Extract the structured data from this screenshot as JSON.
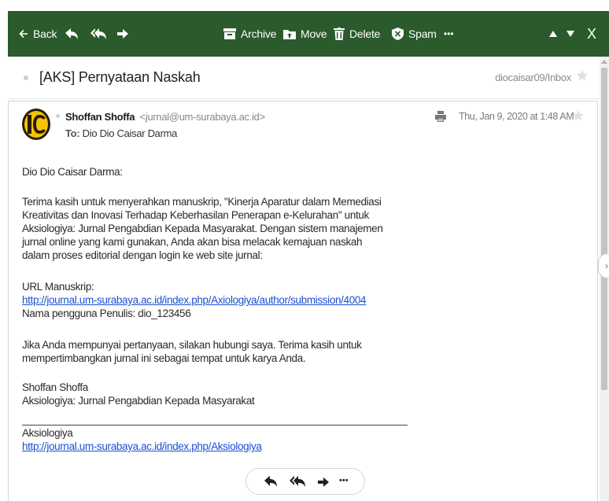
{
  "toolbar": {
    "back_label": "Back",
    "archive_label": "Archive",
    "move_label": "Move",
    "delete_label": "Delete",
    "spam_label": "Spam",
    "more_label": "•••",
    "close_label": "X"
  },
  "subject": {
    "title": "[AKS] Pernyataan Naskah",
    "folder": "diocaisar09/Inbox"
  },
  "message": {
    "sender_name": "Shoffan Shoffa",
    "sender_email": "<jurnal@um-surabaya.ac.id>",
    "to_label": "To:",
    "to_value": "Dio Dio Caisar Darma",
    "date": "Thu, Jan 9, 2020 at 1:48 AM",
    "greeting": "Dio Dio Caisar Darma:",
    "para1_lines": [
      "Terima kasih untuk menyerahkan manuskrip, \"Kinerja Aparatur dalam Memediasi",
      "Kreativitas dan Inovasi Terhadap Keberhasilan Penerapan e-Kelurahan\" untuk",
      "Aksiologiya: Jurnal Pengabdian Kepada Masyarakat. Dengan sistem manajemen",
      "jurnal online yang kami gunakan, Anda akan bisa melacak kemajuan naskah",
      "dalam proses editorial dengan login ke web site jurnal:"
    ],
    "url_label": "URL Manuskrip:",
    "url": "http://journal.um-surabaya.ac.id/index.php/Axiologiya/author/submission/4004",
    "username_line": "Nama pengguna Penulis: dio_123456",
    "para2_lines": [
      "Jika Anda mempunyai pertanyaan, silakan hubungi saya. Terima kasih untuk",
      "mempertimbangkan jurnal ini sebagai tempat untuk karya Anda."
    ],
    "signature_name": "Shoffan Shoffa",
    "signature_journal": "Aksiologiya: Jurnal Pengabdian Kepada Masyarakat",
    "footer_name": "Aksiologiya",
    "footer_url": "http://journal.um-surabaya.ac.id/index.php/Aksiologiya",
    "avatar_letters": "IC"
  },
  "reply_bar": {
    "more_label": "•••"
  },
  "colors": {
    "toolbar_bg": "#2b5a2c",
    "link": "#1a4fd6",
    "avatar_dark": "#2a1a0e",
    "avatar_yellow": "#f2c500"
  }
}
